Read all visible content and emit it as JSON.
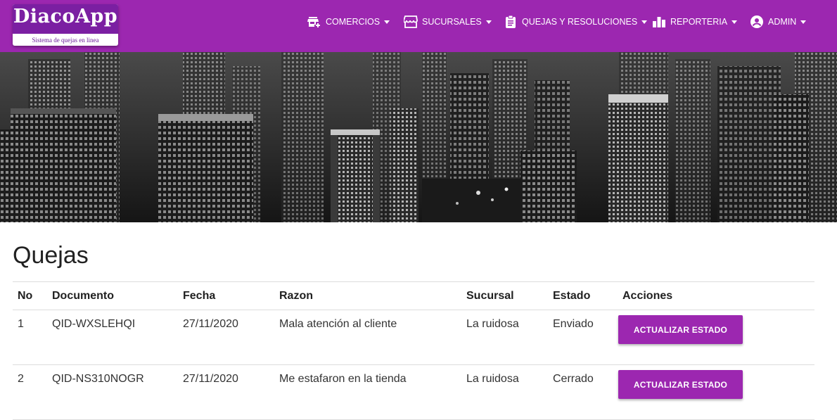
{
  "brand": {
    "name": "DiacoApp",
    "tagline": "Sistema de quejas en linea"
  },
  "nav": [
    {
      "label": "COMERCIOS",
      "icon": "store-add-icon"
    },
    {
      "label": "SUCURSALES",
      "icon": "storefront-icon"
    },
    {
      "label": "QUEJAS Y RESOLUCIONES",
      "icon": "clipboard-icon"
    },
    {
      "label": "REPORTERIA",
      "icon": "bar-chart-icon"
    },
    {
      "label": "ADMIN",
      "icon": "account-circle-icon"
    }
  ],
  "page": {
    "title": "Quejas"
  },
  "table": {
    "headers": [
      "No",
      "Documento",
      "Fecha",
      "Razon",
      "Sucursal",
      "Estado",
      "Acciones"
    ],
    "rows": [
      {
        "no": "1",
        "documento": "QID-WXSLEHQI",
        "fecha": "27/11/2020",
        "razon": "Mala atención al cliente",
        "sucursal": "La ruidosa",
        "estado": "Enviado",
        "accion": "ACTUALIZAR ESTADO"
      },
      {
        "no": "2",
        "documento": "QID-NS310NOGR",
        "fecha": "27/11/2020",
        "razon": "Me estafaron en la tienda",
        "sucursal": "La ruidosa",
        "estado": "Cerrado",
        "accion": "ACTUALIZAR ESTADO"
      }
    ]
  },
  "colors": {
    "primary": "#9c27b0",
    "logo_bg": "#7b1fa2"
  }
}
